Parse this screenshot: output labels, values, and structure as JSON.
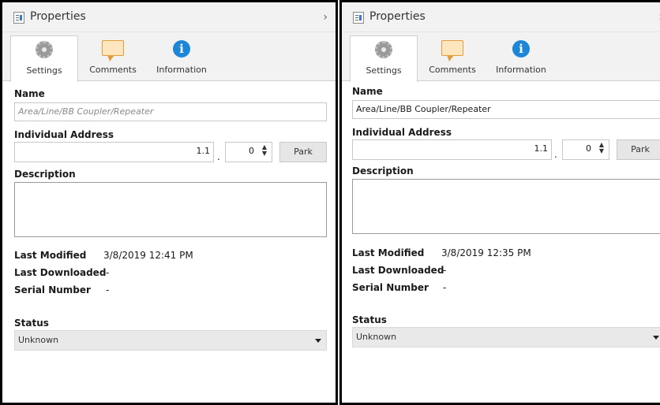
{
  "panels": [
    {
      "title": "Properties",
      "collapse_glyph": "›",
      "tabs": [
        {
          "label": "Settings",
          "icon": "gear-icon",
          "active": true
        },
        {
          "label": "Comments",
          "icon": "comment-icon",
          "active": false
        },
        {
          "label": "Information",
          "icon": "info-icon",
          "active": false
        }
      ],
      "name_label": "Name",
      "name_value": "",
      "name_placeholder": "Area/Line/BB Coupler/Repeater",
      "address_label": "Individual Address",
      "address_prefix": "1.1",
      "address_dot": ".",
      "address_device": "0",
      "park_label": "Park",
      "description_label": "Description",
      "last_modified_label": "Last Modified",
      "last_modified_value": "3/8/2019 12:41 PM",
      "last_downloaded_label": "Last Downloaded",
      "last_downloaded_value": "-",
      "serial_label": "Serial Number",
      "serial_value": "-",
      "status_label": "Status",
      "status_value": "Unknown"
    },
    {
      "title": "Properties",
      "collapse_glyph": "›",
      "tabs": [
        {
          "label": "Settings",
          "icon": "gear-icon",
          "active": true
        },
        {
          "label": "Comments",
          "icon": "comment-icon",
          "active": false
        },
        {
          "label": "Information",
          "icon": "info-icon",
          "active": false
        }
      ],
      "name_label": "Name",
      "name_value": "Area/Line/BB Coupler/Repeater",
      "name_placeholder": "",
      "address_label": "Individual Address",
      "address_prefix": "1.1",
      "address_dot": ".",
      "address_device": "0",
      "park_label": "Park",
      "description_label": "Description",
      "last_modified_label": "Last Modified",
      "last_modified_value": "3/8/2019 12:35 PM",
      "last_downloaded_label": "Last Downloaded",
      "last_downloaded_value": "-",
      "serial_label": "Serial Number",
      "serial_value": "-",
      "status_label": "Status",
      "status_value": "Unknown"
    }
  ]
}
